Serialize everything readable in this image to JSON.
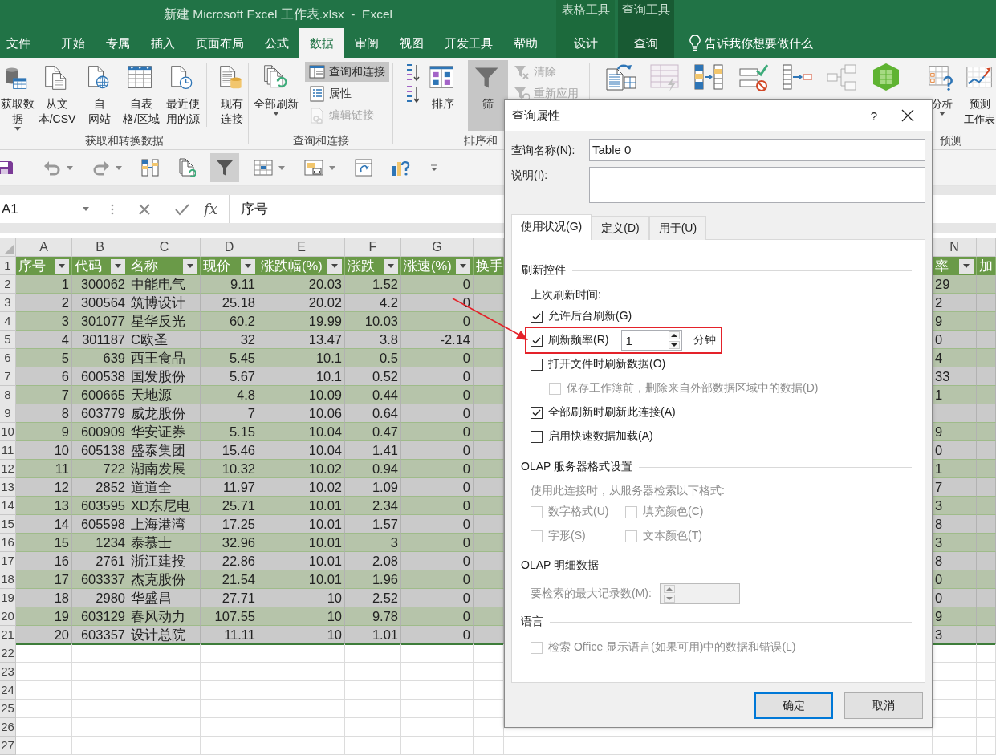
{
  "window": {
    "title": "新建 Microsoft Excel 工作表.xlsx  -  Excel"
  },
  "ribbon_tabs": [
    {
      "label": "文件",
      "selected": false
    },
    {
      "label": "开始",
      "selected": false
    },
    {
      "label": "专属",
      "selected": false
    },
    {
      "label": "插入",
      "selected": false
    },
    {
      "label": "页面布局",
      "selected": false
    },
    {
      "label": "公式",
      "selected": false
    },
    {
      "label": "数据",
      "selected": true
    },
    {
      "label": "审阅",
      "selected": false
    },
    {
      "label": "视图",
      "selected": false
    },
    {
      "label": "开发工具",
      "selected": false
    },
    {
      "label": "帮助",
      "selected": false
    }
  ],
  "context_tab_groups": [
    {
      "label": "表格工具",
      "tabs": [
        {
          "label": "设计",
          "selected": false
        }
      ]
    },
    {
      "label": "查询工具",
      "tabs": [
        {
          "label": "查询",
          "selected": false
        }
      ]
    }
  ],
  "tell_me": {
    "placeholder": "告诉我你想要做什么"
  },
  "ribbon_groups": [
    {
      "label": "获取和转换数据",
      "buttons": [
        {
          "kind": "large",
          "label": "获取数据",
          "dropdown": true,
          "pressed": false,
          "disabled": false
        },
        {
          "kind": "large",
          "label": "从文本/CSV",
          "dropdown": false,
          "pressed": false,
          "disabled": false
        },
        {
          "kind": "large",
          "label": "自网站",
          "dropdown": false,
          "pressed": false,
          "disabled": false
        },
        {
          "kind": "large",
          "label": "自表格/区域",
          "dropdown": false,
          "pressed": false,
          "disabled": false
        },
        {
          "kind": "large",
          "label": "最近使用的源",
          "dropdown": false,
          "pressed": false,
          "disabled": false
        },
        {
          "kind": "large",
          "label": "现有连接",
          "dropdown": false,
          "pressed": false,
          "disabled": false
        }
      ]
    },
    {
      "label": "查询和连接",
      "buttons": [
        {
          "kind": "large",
          "label": "全部刷新",
          "dropdown": true,
          "pressed": false,
          "disabled": false
        },
        {
          "kind": "small",
          "label": "查询和连接",
          "dropdown": false,
          "pressed": true,
          "disabled": false
        },
        {
          "kind": "small",
          "label": "属性",
          "dropdown": false,
          "pressed": false,
          "disabled": false
        },
        {
          "kind": "small",
          "label": "编辑链接",
          "dropdown": false,
          "pressed": false,
          "disabled": true
        }
      ]
    },
    {
      "label": "排序和",
      "buttons": [
        {
          "kind": "small",
          "dropdown": false,
          "pressed": false,
          "disabled": false
        },
        {
          "kind": "small",
          "dropdown": false,
          "pressed": false,
          "disabled": false
        },
        {
          "kind": "large",
          "label": "排序",
          "dropdown": false,
          "pressed": false,
          "disabled": false
        },
        {
          "kind": "large",
          "label": "筛",
          "dropdown": false,
          "pressed": true,
          "disabled": false
        },
        {
          "kind": "small",
          "label": "清除",
          "dropdown": false,
          "pressed": false,
          "disabled": true
        },
        {
          "kind": "small",
          "label": "重新应用",
          "dropdown": false,
          "pressed": false,
          "disabled": true
        }
      ]
    },
    {
      "buttons": [
        {
          "kind": "icon",
          "dropdown": false,
          "pressed": false,
          "disabled": false
        },
        {
          "kind": "icon",
          "dropdown": false,
          "pressed": false,
          "disabled": true
        },
        {
          "kind": "icon",
          "dropdown": false,
          "pressed": false,
          "disabled": false
        },
        {
          "kind": "icon",
          "dropdown": false,
          "pressed": false,
          "disabled": false
        },
        {
          "kind": "icon",
          "dropdown": false,
          "pressed": false,
          "disabled": false
        },
        {
          "kind": "icon",
          "dropdown": false,
          "pressed": false,
          "disabled": true
        },
        {
          "kind": "icon",
          "dropdown": false,
          "pressed": false,
          "disabled": false
        }
      ]
    },
    {
      "label": "预测",
      "buttons": [
        {
          "kind": "large",
          "label": "分析",
          "dropdown": true,
          "pressed": false,
          "disabled": false
        },
        {
          "kind": "large",
          "label": "预测工作表",
          "dropdown": false,
          "pressed": false,
          "disabled": false
        }
      ]
    }
  ],
  "quick_access": [
    {
      "kind": "save",
      "pressed": false,
      "dropdown": false
    },
    {
      "kind": "undo",
      "pressed": false,
      "dropdown": true
    },
    {
      "kind": "redo",
      "pressed": false,
      "dropdown": true
    },
    {
      "kind": "columns",
      "pressed": false,
      "dropdown": false
    },
    {
      "kind": "refresh",
      "pressed": false,
      "dropdown": false
    },
    {
      "kind": "filter",
      "pressed": true,
      "dropdown": false
    },
    {
      "kind": "grid",
      "pressed": false,
      "dropdown": true
    },
    {
      "kind": "table",
      "pressed": false,
      "dropdown": true
    },
    {
      "kind": "refresh-window",
      "pressed": false,
      "dropdown": false
    },
    {
      "kind": "chart-help",
      "pressed": false,
      "dropdown": false
    },
    {
      "kind": "customize",
      "pressed": false,
      "dropdown": false
    }
  ],
  "formula_bar": {
    "name_box": "A1",
    "function_label": "fx",
    "content": "序号"
  },
  "sheet": {
    "column_headers": [
      "A",
      "B",
      "C",
      "D",
      "E",
      "F",
      "G",
      "N"
    ],
    "row_numbers": [
      "1",
      "2",
      "3",
      "4",
      "5",
      "6",
      "7",
      "8",
      "9",
      "10",
      "11",
      "12",
      "13",
      "14",
      "15",
      "16",
      "17",
      "18",
      "19",
      "20",
      "21",
      "22",
      "23",
      "24",
      "25",
      "26",
      "27"
    ],
    "table_header": [
      {
        "label": "序号",
        "filter": true
      },
      {
        "label": "代码",
        "filter": true
      },
      {
        "label": "名称",
        "filter": true
      },
      {
        "label": "现价",
        "filter": true
      },
      {
        "label": "涨跌幅(%)",
        "filter": true
      },
      {
        "label": "涨跌",
        "filter": true
      },
      {
        "label": "涨速(%)",
        "filter": true
      },
      {
        "label": "换手",
        "filter": false
      },
      {
        "label": "率",
        "filter": true
      },
      {
        "label": "加",
        "filter": false
      }
    ],
    "rows": [
      {
        "cells": [
          "1",
          "300062",
          "中能电气",
          "9.11",
          "20.03",
          "1.52",
          "0"
        ],
        "n": "29"
      },
      {
        "cells": [
          "2",
          "300564",
          "筑博设计",
          "25.18",
          "20.02",
          "4.2",
          "0"
        ],
        "n": "2"
      },
      {
        "cells": [
          "3",
          "301077",
          "星华反光",
          "60.2",
          "19.99",
          "10.03",
          "0"
        ],
        "n": "9"
      },
      {
        "cells": [
          "4",
          "301187",
          "C欧圣",
          "32",
          "13.47",
          "3.8",
          "-2.14"
        ],
        "n": "0"
      },
      {
        "cells": [
          "5",
          "639",
          "西王食品",
          "5.45",
          "10.1",
          "0.5",
          "0"
        ],
        "n": "4"
      },
      {
        "cells": [
          "6",
          "600538",
          "国发股份",
          "5.67",
          "10.1",
          "0.52",
          "0"
        ],
        "n": "33"
      },
      {
        "cells": [
          "7",
          "600665",
          "天地源",
          "4.8",
          "10.09",
          "0.44",
          "0"
        ],
        "n": "1"
      },
      {
        "cells": [
          "8",
          "603779",
          "威龙股份",
          "7",
          "10.06",
          "0.64",
          "0"
        ]
      },
      {
        "cells": [
          "9",
          "600909",
          "华安证券",
          "5.15",
          "10.04",
          "0.47",
          "0"
        ],
        "n": "9"
      },
      {
        "cells": [
          "10",
          "605138",
          "盛泰集团",
          "15.46",
          "10.04",
          "1.41",
          "0"
        ],
        "n": "0"
      },
      {
        "cells": [
          "11",
          "722",
          "湖南发展",
          "10.32",
          "10.02",
          "0.94",
          "0"
        ],
        "n": "1"
      },
      {
        "cells": [
          "12",
          "2852",
          "道道全",
          "11.97",
          "10.02",
          "1.09",
          "0"
        ],
        "n": "7"
      },
      {
        "cells": [
          "13",
          "603595",
          "XD东尼电",
          "25.71",
          "10.01",
          "2.34",
          "0"
        ],
        "n": "3"
      },
      {
        "cells": [
          "14",
          "605598",
          "上海港湾",
          "17.25",
          "10.01",
          "1.57",
          "0"
        ],
        "n": "8"
      },
      {
        "cells": [
          "15",
          "1234",
          "泰慕士",
          "32.96",
          "10.01",
          "3",
          "0"
        ],
        "n": "3"
      },
      {
        "cells": [
          "16",
          "2761",
          "浙江建投",
          "22.86",
          "10.01",
          "2.08",
          "0"
        ],
        "n": "8"
      },
      {
        "cells": [
          "17",
          "603337",
          "杰克股份",
          "21.54",
          "10.01",
          "1.96",
          "0"
        ],
        "n": "0"
      },
      {
        "cells": [
          "18",
          "2980",
          "华盛昌",
          "27.71",
          "10",
          "2.52",
          "0"
        ],
        "n": "0"
      },
      {
        "cells": [
          "19",
          "603129",
          "春风动力",
          "107.55",
          "10",
          "9.78",
          "0"
        ],
        "n": "9"
      },
      {
        "cells": [
          "20",
          "603357",
          "设计总院",
          "11.11",
          "10",
          "1.01",
          "0"
        ],
        "n": "3"
      }
    ]
  },
  "dialog": {
    "title": "查询属性",
    "help": "?",
    "name_label": "查询名称(N):",
    "name_value": "Table 0",
    "description_label": "说明(I):",
    "tabs": [
      {
        "label": "使用状况(G)",
        "selected": true
      },
      {
        "label": "定义(D)",
        "selected": false
      },
      {
        "label": "用于(U)",
        "selected": false
      }
    ],
    "sections": [
      {
        "kind": "refresh",
        "title": "刷新控件",
        "note": "上次刷新时间:",
        "options": [
          {
            "kind": "checkbox",
            "label": "允许后台刷新(G)",
            "checked": true,
            "disabled": false,
            "highlighted": false
          },
          {
            "kind": "spin-checkbox",
            "label": "刷新频率(R)",
            "checked": true,
            "disabled": false,
            "highlighted": true,
            "value": "1",
            "unit": "分钟"
          },
          {
            "kind": "checkbox",
            "label": "打开文件时刷新数据(O)",
            "checked": false,
            "disabled": false,
            "highlighted": false,
            "children": [
              {
                "label": "保存工作簿前，删除来自外部数据区域中的数据(D)",
                "checked": false,
                "disabled": true,
                "highlighted": false
              }
            ]
          },
          {
            "kind": "checkbox",
            "label": "全部刷新时刷新此连接(A)",
            "checked": true,
            "disabled": false,
            "highlighted": false
          },
          {
            "kind": "checkbox",
            "label": "启用快速数据加载(A)",
            "checked": false,
            "disabled": false,
            "highlighted": false
          }
        ]
      },
      {
        "kind": "olap-format",
        "title": "OLAP 服务器格式设置",
        "note": "使用此连接时，从服务器检索以下格式:",
        "disabled": true,
        "options": [
          {
            "label": "数字格式(U)",
            "checked": false,
            "disabled": true
          },
          {
            "label": "填充颜色(C)",
            "checked": false,
            "disabled": true
          },
          {
            "label": "字形(S)",
            "checked": false,
            "disabled": true
          },
          {
            "label": "文本颜色(T)",
            "checked": false,
            "disabled": true
          }
        ]
      },
      {
        "kind": "olap-detail",
        "title": "OLAP 明细数据",
        "field_label": "要检索的最大记录数(M):",
        "disabled": true
      },
      {
        "kind": "language",
        "title": "语言",
        "options": [
          {
            "label": "检索 Office 显示语言(如果可用)中的数据和错误(L)",
            "checked": false,
            "disabled": true
          }
        ]
      }
    ],
    "buttons": [
      {
        "label": "确定",
        "default": true
      },
      {
        "label": "取消",
        "default": false
      }
    ]
  }
}
